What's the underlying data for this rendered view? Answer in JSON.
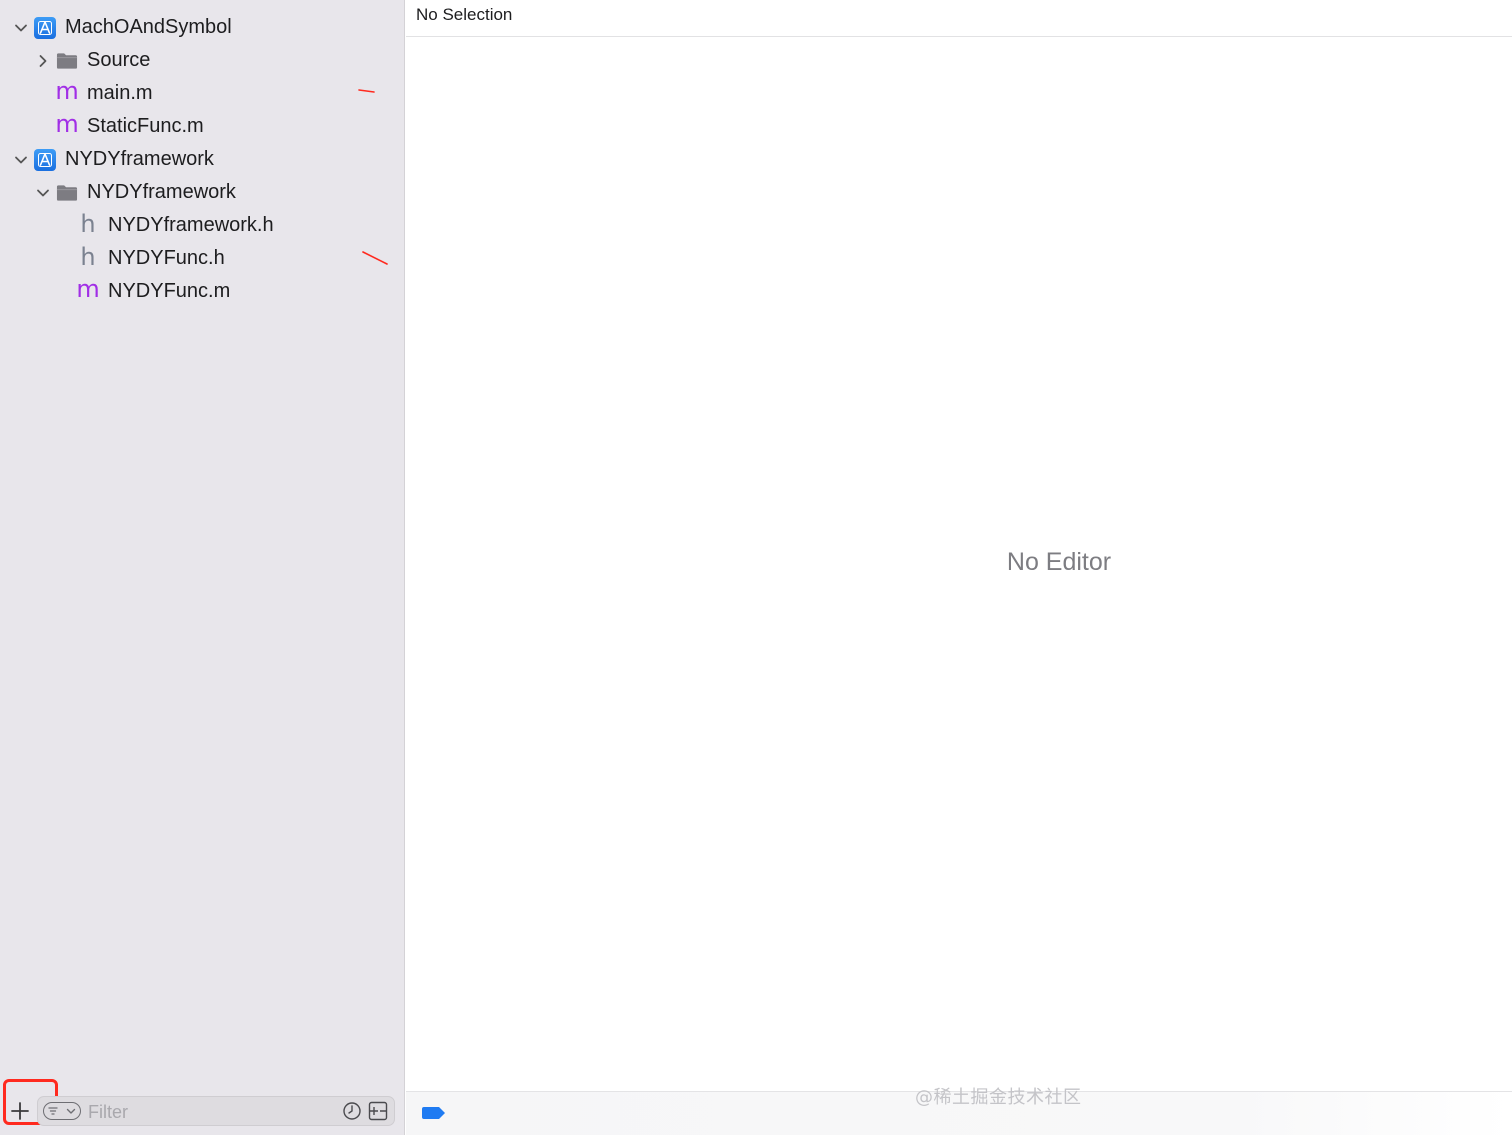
{
  "navigator": {
    "items": [
      {
        "label": "MachOAndSymbol",
        "kind": "project",
        "icon": "xcode-project-icon",
        "expanded": true,
        "depth": 0
      },
      {
        "label": "Source",
        "kind": "folder",
        "icon": "folder-icon",
        "expanded": false,
        "depth": 1
      },
      {
        "label": "main.m",
        "kind": "objc-implementation",
        "icon": "m-file-icon",
        "glyph": "m",
        "depth": 1
      },
      {
        "label": "StaticFunc.m",
        "kind": "objc-implementation",
        "icon": "m-file-icon",
        "glyph": "m",
        "depth": 1
      },
      {
        "label": "NYDYframework",
        "kind": "project",
        "icon": "xcode-project-icon",
        "expanded": true,
        "depth": 0
      },
      {
        "label": "NYDYframework",
        "kind": "folder",
        "icon": "folder-icon",
        "expanded": true,
        "depth": 1
      },
      {
        "label": "NYDYframework.h",
        "kind": "header",
        "icon": "h-file-icon",
        "glyph": "h",
        "depth": 2
      },
      {
        "label": "NYDYFunc.h",
        "kind": "header",
        "icon": "h-file-icon",
        "glyph": "h",
        "depth": 2
      },
      {
        "label": "NYDYFunc.m",
        "kind": "objc-implementation",
        "icon": "m-file-icon",
        "glyph": "m",
        "depth": 2
      }
    ],
    "filter": {
      "add_icon": "plus-icon",
      "options_icon": "filter-options-icon",
      "placeholder": "Filter",
      "recent_icon": "clock-icon",
      "scm_icon": "source-control-icon"
    }
  },
  "editor": {
    "jump_bar_title": "No Selection",
    "placeholder": "No Editor"
  },
  "debug_bar": {
    "breakpoints_icon": "breakpoint-toggle-icon"
  },
  "watermark": "@稀土掘金技术社区",
  "colors": {
    "sidebar_bg": "#e8e6eb",
    "m_file": "#a12ee6",
    "h_file": "#7b8290",
    "project_blue": "#1a6fe0",
    "annotation_red": "#ff2a1f",
    "breakpoint_blue": "#1f7bf2"
  }
}
